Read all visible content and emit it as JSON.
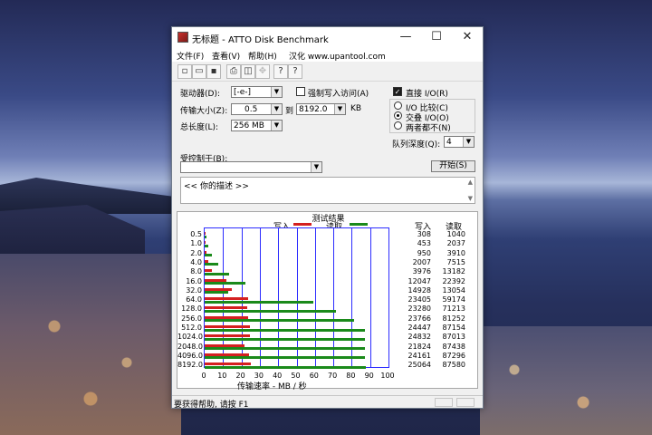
{
  "window": {
    "title": "无标题 - ATTO Disk Benchmark",
    "controls": {
      "minimize": "—",
      "maximize": "☐",
      "close": "✕"
    }
  },
  "menu": [
    "文件(F)",
    "查看(V)",
    "帮助(H)",
    "汉化 www.upantool.com"
  ],
  "toolbar": [
    "new-icon",
    "open-icon",
    "save-icon",
    "print-icon",
    "print-preview-icon",
    "move-icon",
    "help-icon",
    "context-help-icon"
  ],
  "settings": {
    "drive_label": "驱动器(D):",
    "drive_value": "[-e-]",
    "force_write_label": "强制写入访问(A)",
    "force_write_checked": false,
    "transfer_label": "传输大小(Z):",
    "transfer_from": "0.5",
    "transfer_to_label": "到",
    "transfer_to": "8192.0",
    "transfer_unit": "KB",
    "total_label": "总长度(L):",
    "total_value": "256 MB",
    "direct_io_label": "直接 I/O(R)",
    "direct_io_checked": true,
    "radio_compare": "I/O 比较(C)",
    "radio_overlap": "交叠 I/O(O)",
    "radio_neither": "两者都不(N)",
    "radio_selected": "overlap",
    "queue_label": "队列深度(Q):",
    "queue_value": "4",
    "controlled_by_label": "受控制于(B):",
    "controlled_by_value": "",
    "start_button": "开始(S)",
    "description": "<<  你的描述    >>"
  },
  "results": {
    "title": "测试结果",
    "legend_write": "写入",
    "legend_read": "读取",
    "col_write": "写入",
    "col_read": "读取",
    "x_axis_label": "传输速率 - MB / 秒",
    "write_color": "#d42020",
    "read_color": "#1a8a1a"
  },
  "chart_data": {
    "type": "bar",
    "orientation": "horizontal",
    "categories": [
      "0.5",
      "1.0",
      "2.0",
      "4.0",
      "8.0",
      "16.0",
      "32.0",
      "64.0",
      "128.0",
      "256.0",
      "512.0",
      "1024.0",
      "2048.0",
      "4096.0",
      "8192.0"
    ],
    "series": [
      {
        "name": "写入",
        "values": [
          308,
          453,
          950,
          2007,
          3976,
          12047,
          14928,
          23405,
          23280,
          23766,
          24447,
          24832,
          21824,
          24161,
          25064
        ]
      },
      {
        "name": "读取",
        "values": [
          1040,
          2037,
          3910,
          7515,
          13182,
          22392,
          13054,
          59174,
          71213,
          81252,
          87154,
          87013,
          87438,
          87296,
          87580
        ]
      }
    ],
    "xticks": [
      "0",
      "10",
      "20",
      "30",
      "40",
      "50",
      "60",
      "70",
      "80",
      "90",
      "100"
    ],
    "xlim": [
      0,
      100
    ],
    "xlabel": "传输速率 - MB / 秒",
    "grid": true,
    "legend": "top-center"
  },
  "status": {
    "text": "要获得帮助, 请按 F1"
  }
}
